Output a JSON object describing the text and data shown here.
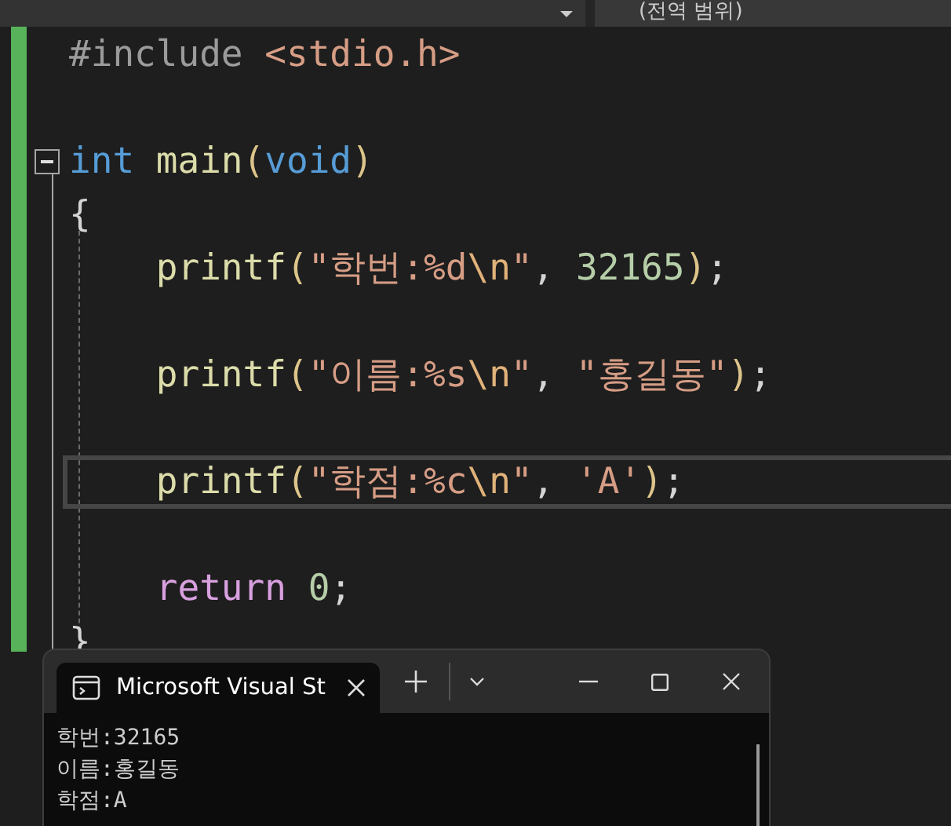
{
  "top_bar": {
    "scope_dropdown": "(전역 범위)"
  },
  "editor": {
    "lines": [
      {
        "collapsible": false,
        "current": false,
        "tokens": [
          {
            "kind": "preprocessor",
            "text": "#include "
          },
          {
            "kind": "string",
            "text": "<stdio.h>"
          }
        ]
      },
      {
        "collapsible": false,
        "current": false
      },
      {
        "collapsible": true,
        "current": false,
        "tokens": [
          {
            "kind": "keyword",
            "text": "int "
          },
          {
            "kind": "function",
            "text": "main"
          },
          {
            "kind": "bracket",
            "text": "("
          },
          {
            "kind": "keyword",
            "text": "void"
          },
          {
            "kind": "bracket",
            "text": ")"
          }
        ]
      },
      {
        "collapsible": false,
        "current": false,
        "tokens": [
          {
            "kind": "punct",
            "text": "{"
          }
        ]
      },
      {
        "collapsible": false,
        "current": false,
        "tokens": [
          {
            "kind": "function",
            "text": "    printf"
          },
          {
            "kind": "bracket",
            "text": "("
          },
          {
            "kind": "string",
            "text": "\"학번:%d"
          },
          {
            "kind": "escape",
            "text": "\\n"
          },
          {
            "kind": "string",
            "text": "\""
          },
          {
            "kind": "punct",
            "text": ", "
          },
          {
            "kind": "number",
            "text": "32165"
          },
          {
            "kind": "bracket",
            "text": ")"
          },
          {
            "kind": "punct",
            "text": ";"
          }
        ]
      },
      {
        "collapsible": false,
        "current": false
      },
      {
        "collapsible": false,
        "current": false,
        "tokens": [
          {
            "kind": "function",
            "text": "    printf"
          },
          {
            "kind": "bracket",
            "text": "("
          },
          {
            "kind": "string",
            "text": "\"이름:%s"
          },
          {
            "kind": "escape",
            "text": "\\n"
          },
          {
            "kind": "string",
            "text": "\""
          },
          {
            "kind": "punct",
            "text": ", "
          },
          {
            "kind": "string",
            "text": "\"홍길동\""
          },
          {
            "kind": "bracket",
            "text": ")"
          },
          {
            "kind": "punct",
            "text": ";"
          }
        ]
      },
      {
        "collapsible": false,
        "current": false
      },
      {
        "collapsible": false,
        "current": true,
        "tokens": [
          {
            "kind": "function",
            "text": "    printf"
          },
          {
            "kind": "bracket",
            "text": "("
          },
          {
            "kind": "string",
            "text": "\"학점:%c"
          },
          {
            "kind": "escape",
            "text": "\\n"
          },
          {
            "kind": "string",
            "text": "\""
          },
          {
            "kind": "punct",
            "text": ", "
          },
          {
            "kind": "string",
            "text": "'A'"
          },
          {
            "kind": "bracket",
            "text": ")"
          },
          {
            "kind": "punct",
            "text": ";"
          }
        ]
      },
      {
        "collapsible": false,
        "current": false
      },
      {
        "collapsible": false,
        "current": false,
        "tokens": [
          {
            "kind": "control",
            "text": "    return "
          },
          {
            "kind": "number",
            "text": "0"
          },
          {
            "kind": "punct",
            "text": ";"
          }
        ]
      },
      {
        "collapsible": false,
        "current": false,
        "tokens": [
          {
            "kind": "punct",
            "text": "}"
          }
        ]
      }
    ]
  },
  "terminal": {
    "tab_title": "Microsoft Visual St",
    "output": [
      "학번:32165",
      "이름:홍길동",
      "학점:A"
    ]
  }
}
